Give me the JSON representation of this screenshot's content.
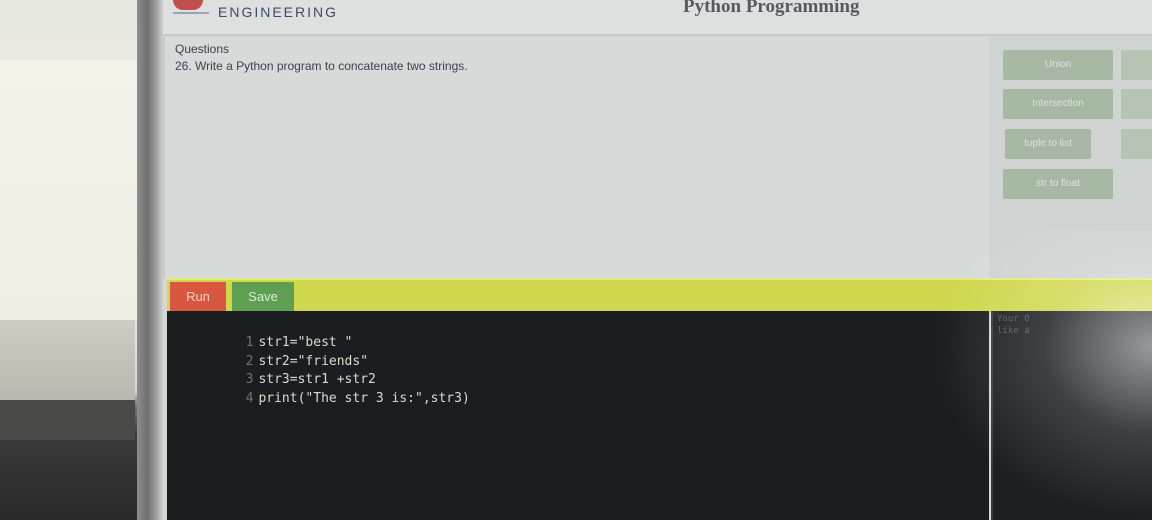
{
  "header": {
    "brand": "ENGINEERING",
    "title": "Python Programming"
  },
  "question": {
    "heading": "Questions",
    "text": "26. Write a Python program to concatenate two strings."
  },
  "side_buttons": [
    "Union",
    "Intersection",
    "tuple to list",
    "str to float"
  ],
  "toolbar": {
    "run_label": "Run",
    "save_label": "Save"
  },
  "editor": {
    "lines": [
      {
        "number": "1",
        "code": "str1=\"best \""
      },
      {
        "number": "2",
        "code": "str2=\"friends\""
      },
      {
        "number": "3",
        "code": "str3=str1 +str2"
      },
      {
        "number": "4",
        "code": "print(\"The str 3 is:\",str3)"
      }
    ]
  },
  "output": {
    "hint_line1": "Your O",
    "hint_line2": "like a"
  },
  "colors": {
    "run": "#d9573e",
    "save": "#5e9f52",
    "toolbar": "#cfd84f",
    "editor_bg": "#1b1d20"
  }
}
